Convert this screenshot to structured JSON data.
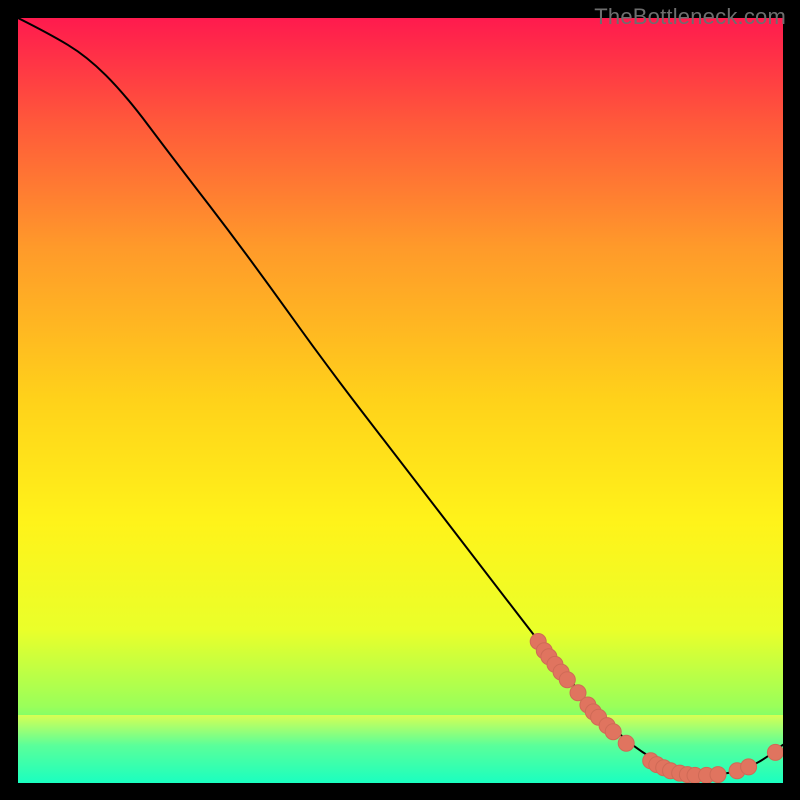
{
  "watermark": "TheBottleneck.com",
  "colors": {
    "curve": "#000000",
    "dot_fill": "#e0745f",
    "dot_stroke": "#cf6a56",
    "gradient_stops": [
      "#ff1a4e",
      "#ff5a3a",
      "#ff9a2a",
      "#ffd21a",
      "#fff31a",
      "#eaff2a",
      "#9aff5a",
      "#2aff9a",
      "#1affc0"
    ],
    "green_band_top": "#d7ff53",
    "green_band_mid": "#5aff9a",
    "green_band_bot": "#1affc0"
  },
  "chart_data": {
    "type": "line",
    "title": "",
    "xlabel": "",
    "ylabel": "",
    "xlim": [
      0,
      100
    ],
    "ylim": [
      0,
      100
    ],
    "curve": [
      {
        "x": 0,
        "y": 100
      },
      {
        "x": 4,
        "y": 98
      },
      {
        "x": 9,
        "y": 95
      },
      {
        "x": 14,
        "y": 90
      },
      {
        "x": 20,
        "y": 82
      },
      {
        "x": 30,
        "y": 69
      },
      {
        "x": 40,
        "y": 55
      },
      {
        "x": 50,
        "y": 42
      },
      {
        "x": 60,
        "y": 29
      },
      {
        "x": 70,
        "y": 16
      },
      {
        "x": 75,
        "y": 10
      },
      {
        "x": 80,
        "y": 5
      },
      {
        "x": 85,
        "y": 2
      },
      {
        "x": 88,
        "y": 1
      },
      {
        "x": 91,
        "y": 1
      },
      {
        "x": 94,
        "y": 1.5
      },
      {
        "x": 97,
        "y": 2.7
      },
      {
        "x": 100,
        "y": 5
      }
    ],
    "dots": [
      {
        "x": 68.0,
        "y": 18.5
      },
      {
        "x": 68.8,
        "y": 17.3
      },
      {
        "x": 69.4,
        "y": 16.5
      },
      {
        "x": 70.2,
        "y": 15.5
      },
      {
        "x": 71.0,
        "y": 14.5
      },
      {
        "x": 71.8,
        "y": 13.5
      },
      {
        "x": 73.2,
        "y": 11.8
      },
      {
        "x": 74.5,
        "y": 10.2
      },
      {
        "x": 75.2,
        "y": 9.3
      },
      {
        "x": 75.9,
        "y": 8.6
      },
      {
        "x": 77.0,
        "y": 7.5
      },
      {
        "x": 77.8,
        "y": 6.7
      },
      {
        "x": 79.5,
        "y": 5.2
      },
      {
        "x": 82.7,
        "y": 2.9
      },
      {
        "x": 83.5,
        "y": 2.4
      },
      {
        "x": 84.4,
        "y": 2.0
      },
      {
        "x": 85.3,
        "y": 1.6
      },
      {
        "x": 86.5,
        "y": 1.3
      },
      {
        "x": 87.5,
        "y": 1.1
      },
      {
        "x": 88.5,
        "y": 1.0
      },
      {
        "x": 90.0,
        "y": 1.0
      },
      {
        "x": 91.5,
        "y": 1.1
      },
      {
        "x": 94.0,
        "y": 1.6
      },
      {
        "x": 95.5,
        "y": 2.1
      },
      {
        "x": 99.0,
        "y": 4.0
      }
    ],
    "dot_radius_px": 8
  }
}
